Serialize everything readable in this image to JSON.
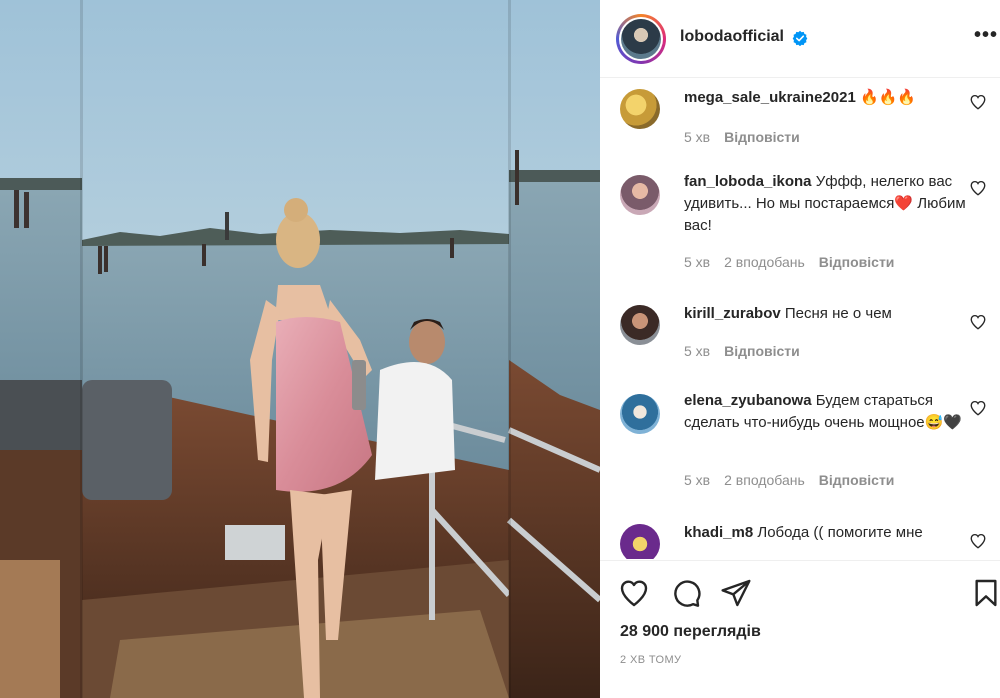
{
  "post": {
    "username": "lobodaofficial",
    "verified": true,
    "more_label": "•••",
    "views": "28 900 переглядів",
    "posted_time": "2 ХВ ТОМУ"
  },
  "comments": [
    {
      "user": "mega_sale_ukraine2021",
      "text": "🔥🔥🔥",
      "time": "5 хв",
      "likes": "",
      "reply": "Відповісти"
    },
    {
      "user": "fan_loboda_ikona",
      "text": "Уффф, нелегко вас удивить... Но мы постараемся❤️ Любим вас!",
      "time": "5 хв",
      "likes": "2 вподобань",
      "reply": "Відповісти"
    },
    {
      "user": "kirill_zurabov",
      "text": "Песня не о чем",
      "time": "5 хв",
      "likes": "",
      "reply": "Відповісти"
    },
    {
      "user": "elena_zyubanowa",
      "text": "Будем стараться сделать что-нибудь очень мощное😅🖤",
      "time": "5 хв",
      "likes": "2 вподобань",
      "reply": "Відповісти"
    },
    {
      "user": "khadi_m8",
      "text": "Лобода (( помогите мне",
      "time": "",
      "likes": "",
      "reply": ""
    }
  ],
  "icons": {
    "like": "heart-icon",
    "comment": "comment-icon",
    "share": "share-icon",
    "save": "bookmark-icon",
    "verified": "verified-badge-icon",
    "comment_like": "heart-icon"
  },
  "colors": {
    "verified": "#0095f6",
    "secondary_text": "#8e8e8e",
    "primary_text": "#262626"
  }
}
